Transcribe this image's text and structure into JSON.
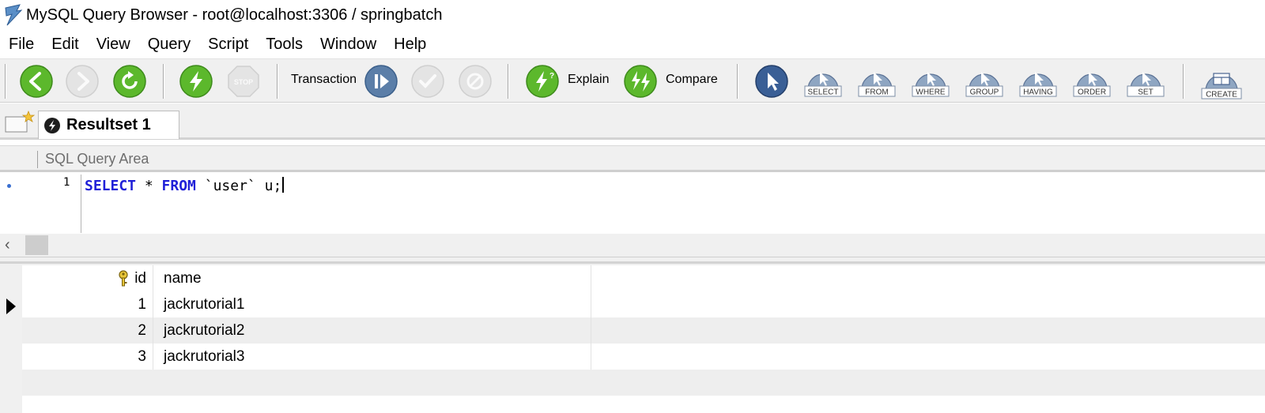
{
  "window": {
    "title": "MySQL Query Browser - root@localhost:3306 / springbatch"
  },
  "menu": [
    "File",
    "Edit",
    "View",
    "Query",
    "Script",
    "Tools",
    "Window",
    "Help"
  ],
  "toolbar": {
    "transaction_label": "Transaction",
    "explain_label": "Explain",
    "compare_label": "Compare",
    "clause_buttons": [
      "SELECT",
      "FROM",
      "WHERE",
      "GROUP",
      "HAVING",
      "ORDER",
      "SET"
    ],
    "create_label": "CREATE"
  },
  "tabs": [
    {
      "label": "Resultset 1",
      "active": true
    }
  ],
  "sql_area": {
    "header": "SQL Query Area",
    "line_number": "1",
    "tokens": [
      {
        "text": "SELECT",
        "kind": "keyword"
      },
      {
        "text": " * ",
        "kind": "plain"
      },
      {
        "text": "FROM",
        "kind": "keyword"
      },
      {
        "text": " `user` u;",
        "kind": "plain"
      }
    ]
  },
  "results": {
    "columns": [
      "id",
      "name"
    ],
    "rows": [
      {
        "id": "1",
        "name": "jackrutorial1",
        "selected": true
      },
      {
        "id": "2",
        "name": "jackrutorial2",
        "selected": false
      },
      {
        "id": "3",
        "name": "jackrutorial3",
        "selected": false
      }
    ]
  },
  "colors": {
    "keyword": "#2020d8",
    "green_button": "#4caf1e",
    "blue_button": "#4a6fa0",
    "toolbar_bg": "#f0f0f0",
    "alt_row": "#eeeeee"
  },
  "icons": [
    "app-logo-icon",
    "back-icon",
    "forward-icon",
    "refresh-icon",
    "execute-icon",
    "stop-icon",
    "transaction-start-icon",
    "commit-icon",
    "rollback-icon",
    "explain-icon",
    "compare-icon",
    "pointer-icon",
    "clause-select-icon",
    "clause-from-icon",
    "clause-where-icon",
    "clause-group-icon",
    "clause-having-icon",
    "clause-order-icon",
    "clause-set-icon",
    "create-icon",
    "new-tab-icon",
    "resultset-icon",
    "primary-key-icon"
  ]
}
